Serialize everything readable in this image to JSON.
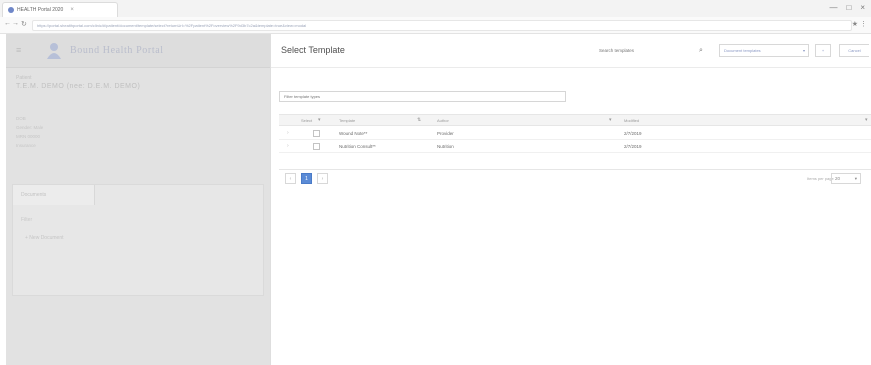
{
  "browser": {
    "tab_title": "HEALTH Portal 2020",
    "tab_close": "×",
    "url": "https://portal.shealthportal.com/clinic/#/patient/document/template/select?returnUrl=%2Fpatient%2Foverview%2F9d3b7c2a&template=true&view=modal",
    "window_controls": [
      "—",
      "□",
      "×"
    ]
  },
  "app": {
    "portal_title": "Bound Health Portal",
    "patient_label": "Patient",
    "patient_name": "T.E.M. DEMO (nee: D.E.M. DEMO)",
    "info_lines": [
      "DOB",
      "Gender: Male",
      "MRN 00000",
      "Insurance"
    ],
    "panel_tab": "Documents",
    "panel_sub": "Filter",
    "panel_item": "+ New Document"
  },
  "modal": {
    "title": "Select Template",
    "search_placeholder": "Search templates",
    "select_value": "Document templates",
    "btn_small": "+",
    "btn_cancel": "Cancel",
    "filter_placeholder": "Filter template types",
    "columns": {
      "select": "Select",
      "template": "Template",
      "author": "Author",
      "modified": "Modified"
    },
    "rows": [
      {
        "template": "Wound Note**",
        "author": "Provider",
        "modified": "2/7/2019"
      },
      {
        "template": "Nutrition Consult**",
        "author": "Nutrition",
        "modified": "2/7/2019"
      }
    ],
    "pager": {
      "prev": "‹",
      "page": "1",
      "next": "›",
      "size_label": "Items per page",
      "size_value": "20"
    }
  }
}
